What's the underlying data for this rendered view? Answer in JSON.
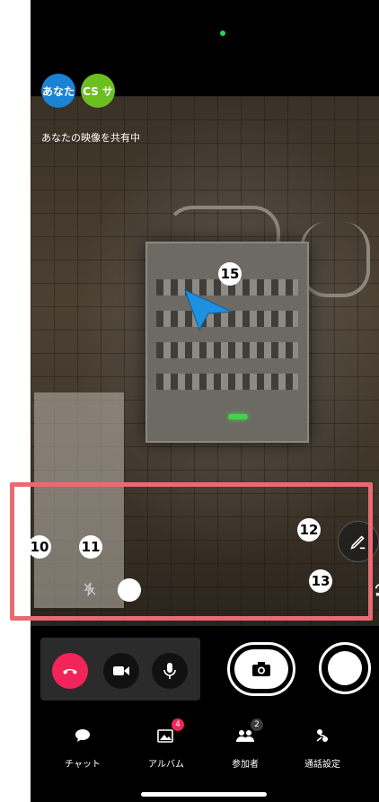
{
  "participants": {
    "you_label": "あなた",
    "cs_label": "CS サ",
    "sharing_status": "あなたの映像を共有中"
  },
  "annotations": {
    "n10": "10",
    "n11": "11",
    "n12": "12",
    "n13": "13",
    "n15": "15"
  },
  "colors": {
    "highlight": "#e86a73",
    "end_call": "#f22459",
    "you_avatar": "#1a83d6",
    "cs_avatar": "#6cbf21",
    "pointer": "#1e90e0"
  },
  "icons": {
    "flash": "flash-off-icon",
    "draw": "pen-icon",
    "rotate": "camera-switch-icon",
    "end_call": "phone-hangup-icon",
    "video": "video-camera-icon",
    "mic": "microphone-icon",
    "snapshot": "camera-icon",
    "record": "record-icon"
  },
  "tabs": [
    {
      "label": "チャット",
      "icon": "chat-bubble-icon"
    },
    {
      "label": "アルバム",
      "icon": "album-icon",
      "badge": "4"
    },
    {
      "label": "参加者",
      "icon": "participants-icon",
      "count": "2"
    },
    {
      "label": "通話設定",
      "icon": "settings-icon"
    }
  ]
}
